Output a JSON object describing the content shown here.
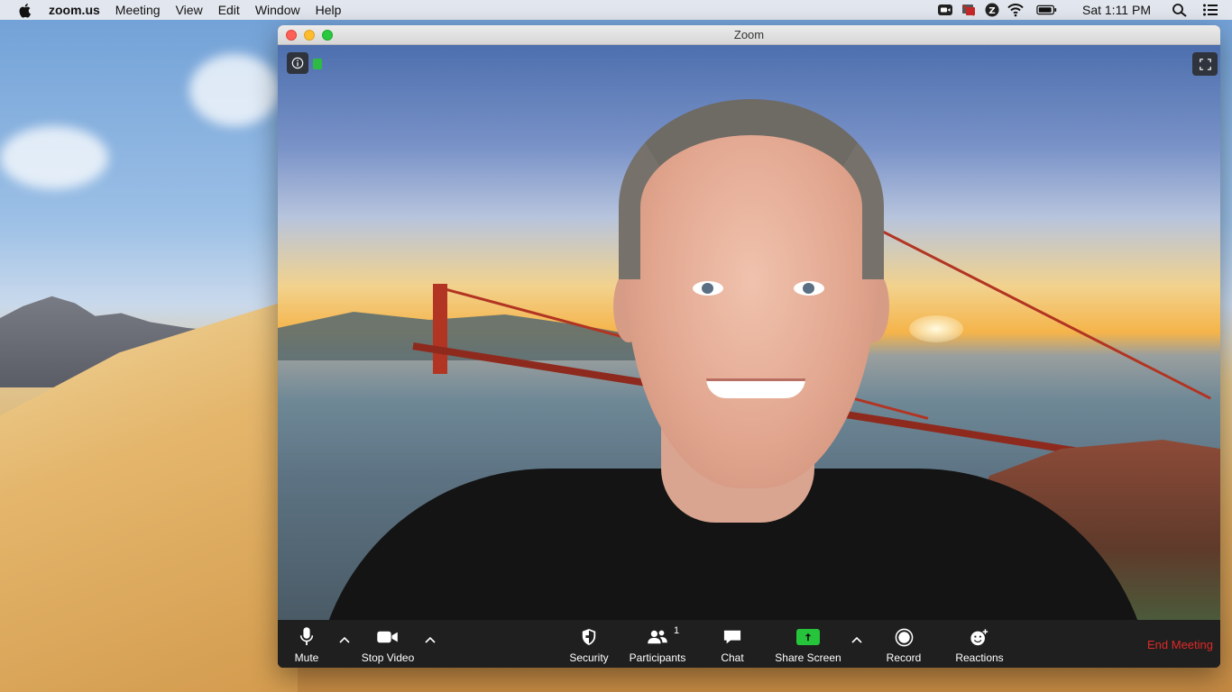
{
  "menubar": {
    "app_name": "zoom.us",
    "items": [
      "Meeting",
      "View",
      "Edit",
      "Window",
      "Help"
    ],
    "clock": "Sat 1:11 PM",
    "status_icons": [
      "zoom-video-icon",
      "screen-share-icon",
      "zoom-z-icon",
      "wifi-icon",
      "battery-icon",
      "spotlight-search-icon",
      "notification-center-icon"
    ]
  },
  "window": {
    "title": "Zoom"
  },
  "toolbar": {
    "mute_label": "Mute",
    "stop_video_label": "Stop Video",
    "security_label": "Security",
    "participants_label": "Participants",
    "participants_count": "1",
    "chat_label": "Chat",
    "share_screen_label": "Share Screen",
    "record_label": "Record",
    "reactions_label": "Reactions",
    "end_meeting_label": "End Meeting"
  },
  "colors": {
    "end_meeting": "#e02828",
    "share_screen_accent": "#25c43b",
    "toolbar_bg": "#1f1f1f"
  }
}
